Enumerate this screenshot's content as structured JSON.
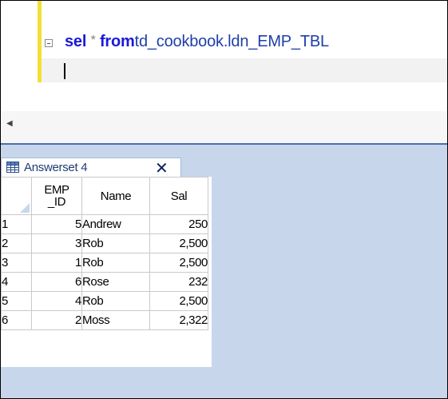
{
  "editor": {
    "keyword_select": "sel",
    "operator": "*",
    "keyword_from": "from",
    "table_name": "td_cookbook.ldn_EMP_TBL",
    "scroll_left_glyph": "◀"
  },
  "results": {
    "tab_label": "Answerset 4",
    "close_glyph": "✕",
    "columns": [
      "EMP\n_ID",
      "Name",
      "Sal"
    ],
    "rows": [
      {
        "num": "1",
        "emp_id": "5",
        "name": "Andrew",
        "sal": "250"
      },
      {
        "num": "2",
        "emp_id": "3",
        "name": "Rob",
        "sal": "2,500"
      },
      {
        "num": "3",
        "emp_id": "1",
        "name": "Rob",
        "sal": "2,500"
      },
      {
        "num": "4",
        "emp_id": "6",
        "name": "Rose",
        "sal": "232"
      },
      {
        "num": "5",
        "emp_id": "4",
        "name": "Rob",
        "sal": "2,500"
      },
      {
        "num": "6",
        "emp_id": "2",
        "name": "Moss",
        "sal": "2,322"
      }
    ]
  },
  "colors": {
    "keyword": "#1a1ad6",
    "identifier": "#1f3fa6",
    "change_bar": "#f2e035",
    "results_bg": "#c8d6ec"
  },
  "icons": {
    "tab_icon": "grid-table-icon",
    "collapse": "collapse-minus-icon",
    "close": "close-icon",
    "scroll": "scroll-left-icon"
  }
}
